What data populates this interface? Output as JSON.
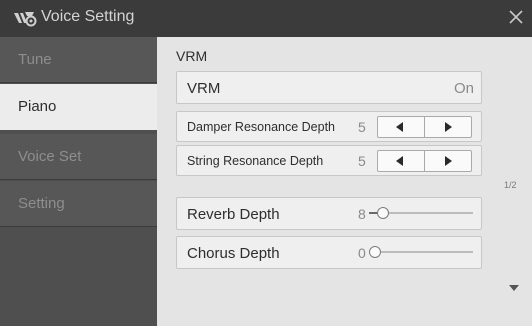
{
  "window": {
    "title": "Voice Setting",
    "icon": "keyboard-gear-icon",
    "close_icon": "close-icon"
  },
  "sidebar": {
    "tabs": [
      {
        "label": "Tune",
        "active": false
      },
      {
        "label": "Piano",
        "active": true
      },
      {
        "label": "Voice Set",
        "active": false
      },
      {
        "label": "Setting",
        "active": false
      }
    ]
  },
  "main": {
    "section_label": "VRM",
    "vrm": {
      "label": "VRM",
      "value": "On"
    },
    "damper": {
      "label": "Damper Resonance Depth",
      "value": "5"
    },
    "string": {
      "label": "String Resonance Depth",
      "value": "5"
    },
    "reverb": {
      "label": "Reverb Depth",
      "value": "8",
      "level": 0.09
    },
    "chorus": {
      "label": "Chorus Depth",
      "value": "0",
      "level": 0
    },
    "page_indicator": "1/2",
    "scroll_down_icon": "triangle-down-icon"
  },
  "colors": {
    "titlebar": "#3b3b3b",
    "sidebar": "#4f4f4f",
    "active_tab": "#ececec",
    "panel": "#e4e4e4"
  }
}
